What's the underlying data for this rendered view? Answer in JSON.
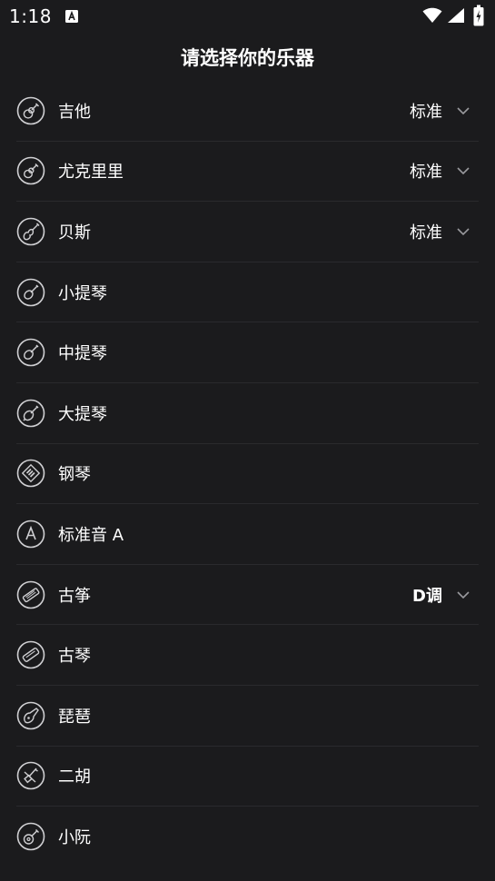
{
  "status_bar": {
    "time": "1:18",
    "notification_icon": "a-box-icon",
    "wifi_icon": "wifi-icon",
    "signal_icon": "signal-icon",
    "battery_icon": "battery-charging-icon"
  },
  "title": "请选择你的乐器",
  "instruments": [
    {
      "label": "吉他",
      "tuning": "标准",
      "icon": "guitar-icon"
    },
    {
      "label": "尤克里里",
      "tuning": "标准",
      "icon": "ukulele-icon"
    },
    {
      "label": "贝斯",
      "tuning": "标准",
      "icon": "bass-icon"
    },
    {
      "label": "小提琴",
      "tuning": "",
      "icon": "violin-icon"
    },
    {
      "label": "中提琴",
      "tuning": "",
      "icon": "viola-icon"
    },
    {
      "label": "大提琴",
      "tuning": "",
      "icon": "cello-icon"
    },
    {
      "label": "钢琴",
      "tuning": "",
      "icon": "piano-icon"
    },
    {
      "label": "标准音 A",
      "tuning": "",
      "icon": "letter-a-icon"
    },
    {
      "label": "古筝",
      "tuning": "D调",
      "icon": "guzheng-icon"
    },
    {
      "label": "古琴",
      "tuning": "",
      "icon": "guqin-icon"
    },
    {
      "label": "琵琶",
      "tuning": "",
      "icon": "pipa-icon"
    },
    {
      "label": "二胡",
      "tuning": "",
      "icon": "erhu-icon"
    },
    {
      "label": "小阮",
      "tuning": "",
      "icon": "ruan-icon"
    }
  ],
  "colors": {
    "background": "#1b1b1d",
    "text": "#ffffff",
    "divider": "#2a2a2d",
    "icon_stroke": "#cfcfd2",
    "chevron": "#9a9a9e"
  }
}
